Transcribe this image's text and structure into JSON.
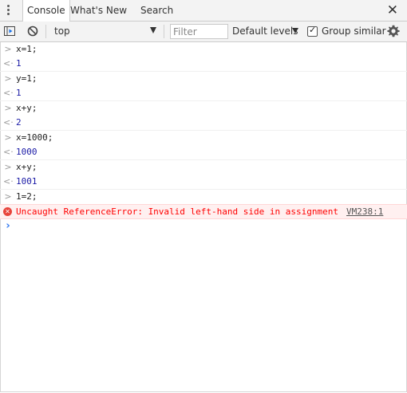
{
  "tabs": {
    "console": "Console",
    "whats_new": "What's New",
    "search": "Search"
  },
  "close_label": "✕",
  "toolbar": {
    "context": "top",
    "filter_placeholder": "Filter",
    "levels": "Default levels",
    "group_similar": "Group similar",
    "group_similar_checked": true
  },
  "console": {
    "entries": [
      {
        "kind": "input",
        "text": "x=1;"
      },
      {
        "kind": "output",
        "text": "1"
      },
      {
        "kind": "input",
        "text": "y=1;"
      },
      {
        "kind": "output",
        "text": "1"
      },
      {
        "kind": "input",
        "text": "x+y;"
      },
      {
        "kind": "output",
        "text": "2"
      },
      {
        "kind": "input",
        "text": "x=1000;"
      },
      {
        "kind": "output",
        "text": "1000"
      },
      {
        "kind": "input",
        "text": "x+y;"
      },
      {
        "kind": "output",
        "text": "1001"
      },
      {
        "kind": "input",
        "text": "1=2;"
      }
    ],
    "error": {
      "message": "Uncaught ReferenceError: Invalid left-hand side in assignment",
      "source": "VM238:1"
    },
    "prompt": "›"
  },
  "colors": {
    "output": "#1a1aa6",
    "error": "#ff0000",
    "prompt": "#367cf1"
  }
}
